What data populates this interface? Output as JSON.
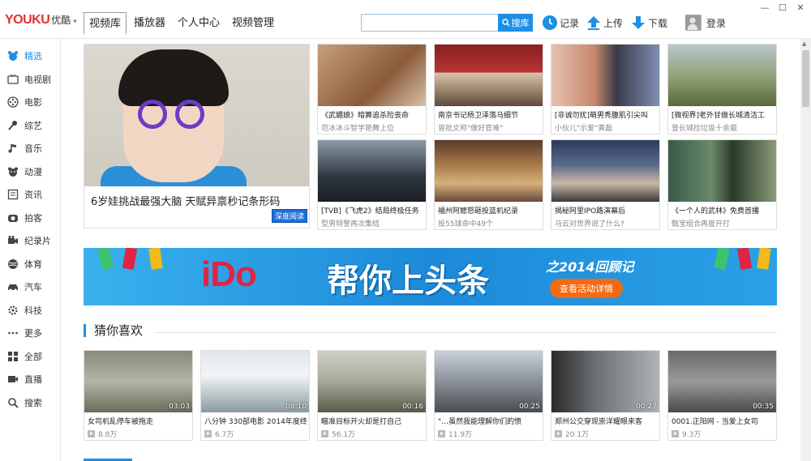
{
  "app": {
    "logo": {
      "youku": "YOUKU",
      "cn": "优酷"
    },
    "tabs": [
      {
        "label": "视频库",
        "active": true
      },
      {
        "label": "播放器",
        "active": false
      },
      {
        "label": "个人中心",
        "active": false
      },
      {
        "label": "视频管理",
        "active": false
      }
    ],
    "search": {
      "placeholder": "",
      "button_label": "搜库"
    },
    "tools": {
      "record": "记录",
      "upload": "上传",
      "download": "下载",
      "login": "登录"
    },
    "accent": "#1e8fe6"
  },
  "sidebar": {
    "items": [
      {
        "label": "精选",
        "icon": "bear-icon",
        "active": true
      },
      {
        "label": "电视剧",
        "icon": "tv-icon"
      },
      {
        "label": "电影",
        "icon": "film-reel-icon"
      },
      {
        "label": "综艺",
        "icon": "microphone-icon"
      },
      {
        "label": "音乐",
        "icon": "music-note-icon"
      },
      {
        "label": "动漫",
        "icon": "bear-face-icon"
      },
      {
        "label": "资讯",
        "icon": "news-icon"
      },
      {
        "label": "拍客",
        "icon": "camera-icon"
      },
      {
        "label": "纪录片",
        "icon": "video-camera-icon"
      },
      {
        "label": "体育",
        "icon": "ball-icon"
      },
      {
        "label": "汽车",
        "icon": "car-icon"
      },
      {
        "label": "科技",
        "icon": "gear-icon"
      },
      {
        "label": "更多",
        "icon": "more-dots-icon"
      },
      {
        "label": "全部",
        "icon": "grid-icon"
      },
      {
        "label": "直播",
        "icon": "live-icon"
      },
      {
        "label": "搜索",
        "icon": "search-icon"
      }
    ]
  },
  "feature": {
    "title": "6岁娃挑战最强大脑 天赋异禀秒记条形码",
    "badge": "深度阅读"
  },
  "top_cards": [
    {
      "t1": "《武媚娘》暗算追杀险丧命",
      "t2": "范冰冰斗智学艳舞上位"
    },
    {
      "t1": "南京书记杨卫泽落马细节",
      "t2": "曾批文称\"做好官难\""
    },
    {
      "t1": "[非诚勿扰]萌男秀腹肌引尖叫",
      "t2": "小伙儿\"示爱\"黄磊"
    },
    {
      "t1": "[微视界]老外甘做长城清洁工",
      "t2": "登长城捡垃圾十余载"
    },
    {
      "t1": "[TVB]《飞虎2》结局终极任务",
      "t2": "型男特警再次集结"
    },
    {
      "t1": "福州阿嬷怒砸投篮机纪录",
      "t2": "投55球命中49个"
    },
    {
      "t1": "揭秘阿里IPO路演幕后",
      "t2": "马云对世界说了什么?"
    },
    {
      "t1": "《一个人的武林》免费首播",
      "t2": "甄宝组合再度开打"
    }
  ],
  "banner": {
    "ido_i": "i",
    "ido_do": "Do",
    "slogan": "帮你上头条",
    "year": "之2014回顾记",
    "button": "查看活动详情"
  },
  "section": {
    "title": "猜你喜欢"
  },
  "videos": [
    {
      "title": "女司机乱停车被拖走",
      "duration": "03:03",
      "views": "8.8万"
    },
    {
      "title": "八分钟 330部电影 2014年度终",
      "duration": "08:10",
      "views": "6.7万"
    },
    {
      "title": "瞄准目标开火却是打自己",
      "duration": "00:16",
      "views": "56.1万"
    },
    {
      "title": "\"…虽然我能理解你们的愤",
      "duration": "00:25",
      "views": "11.9万"
    },
    {
      "title": "郑州公交穿现崇洋耀眼来客",
      "duration": "00:27",
      "views": "20.1万"
    },
    {
      "title": "0001.正阳网 - 当爱上女司",
      "duration": "00:35",
      "views": "9.3万"
    }
  ]
}
